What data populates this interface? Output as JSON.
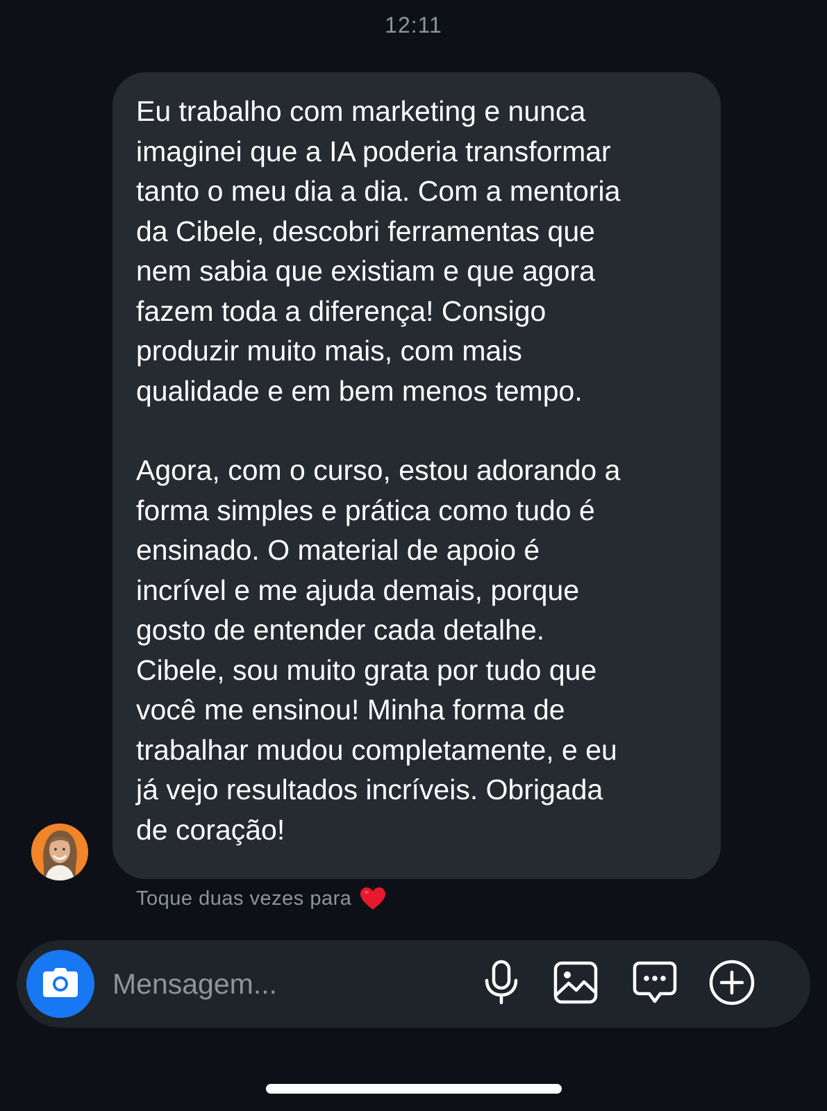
{
  "header": {
    "time": "12:11"
  },
  "message": {
    "paragraphs": [
      "Eu trabalho com marketing e nunca\nimaginei que a IA poderia transformar\ntanto o meu dia a dia. Com a mentoria\nda Cibele, descobri ferramentas que\nnem sabia que existiam e que agora\nfazem toda a diferença! Consigo\nproduzir muito mais, com mais\nqualidade e em bem menos tempo.",
      "Agora, com o curso, estou adorando a\nforma simples e prática como tudo é\nensinado. O material de apoio é\nincrível e me ajuda demais, porque\ngosto de entender cada detalhe.\nCibele, sou muito grata por tudo que\nvocê me ensinou! Minha forma de\ntrabalhar mudou completamente, e eu\njá vejo resultados incríveis. Obrigada\nde coração!"
    ]
  },
  "hint": {
    "text": "Toque duas vezes para",
    "icon": "heart-icon"
  },
  "composer": {
    "placeholder": "Mensagem...",
    "icons": [
      "camera-icon",
      "microphone-icon",
      "image-icon",
      "chat-bubble-icon",
      "plus-circle-icon"
    ],
    "accent_color": "#1877f2"
  }
}
